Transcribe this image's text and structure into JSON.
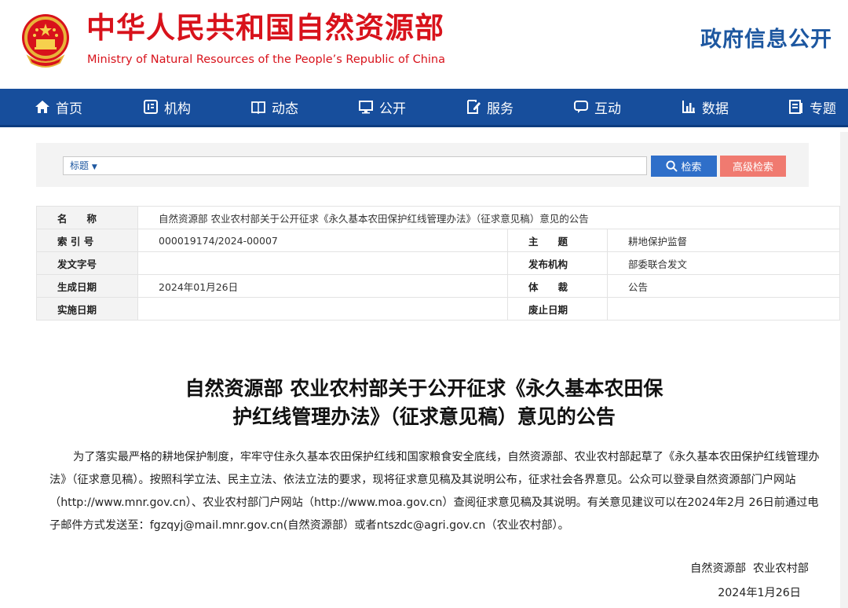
{
  "header": {
    "title": "中华人民共和国自然资源部",
    "subtitle": "Ministry of Natural Resources of the People’s Republic of China",
    "gov_info_link": "政府信息公开"
  },
  "nav": {
    "items": [
      {
        "label": "首页",
        "icon": "home-icon"
      },
      {
        "label": "机构",
        "icon": "org-icon"
      },
      {
        "label": "动态",
        "icon": "book-icon"
      },
      {
        "label": "公开",
        "icon": "monitor-icon"
      },
      {
        "label": "服务",
        "icon": "document-edit-icon"
      },
      {
        "label": "互动",
        "icon": "chat-icon"
      },
      {
        "label": "数据",
        "icon": "bar-chart-icon"
      },
      {
        "label": "专题",
        "icon": "topic-icon"
      }
    ]
  },
  "search": {
    "field_selected": "标题",
    "search_label": "检索",
    "advanced_label": "高级检索"
  },
  "meta": {
    "name_label": "名　　称",
    "name_value": "自然资源部 农业农村部关于公开征求《永久基本农田保护红线管理办法》（征求意见稿）意见的公告",
    "index_label": "索 引 号",
    "index_value": "000019174/2024-00007",
    "subject_label": "主　　题",
    "subject_value": "耕地保护监督",
    "doc_no_label": "发文字号",
    "doc_no_value": "",
    "issuer_label": "发布机构",
    "issuer_value": "部委联合发文",
    "created_label": "生成日期",
    "created_value": "2024年01月26日",
    "genre_label": "体　　裁",
    "genre_value": "公告",
    "effective_label": "实施日期",
    "effective_value": "",
    "repeal_label": "废止日期",
    "repeal_value": ""
  },
  "article": {
    "title_line1": "自然资源部 农业农村部关于公开征求《永久基本农田保",
    "title_line2": "护红线管理办法》（征求意见稿）意见的公告",
    "body": "为了落实最严格的耕地保护制度，牢牢守住永久基本农田保护红线和国家粮食安全底线，自然资源部、农业农村部起草了《永久基本农田保护红线管理办法》（征求意见稿）。按照科学立法、民主立法、依法立法的要求，现将征求意见稿及其说明公布，征求社会各界意见。公众可以登录自然资源部门户网站（http://www.mnr.gov.cn）、农业农村部门户网站（http://www.moa.gov.cn）查阅征求意见稿及其说明。有关意见建议可以在2024年2月 26日前通过电子邮件方式发送至：fgzqyj@mail.mnr.gov.cn(自然资源部）或者ntszdc@agri.gov.cn（农业农村部）。",
    "signature": "自然资源部  农业农村部",
    "date": "2024年1月26日"
  },
  "colors": {
    "brand_red": "#d8121b",
    "nav_blue": "#174e9c",
    "title_blue": "#1d57a0",
    "search_blue": "#2f6fc9",
    "advanced_red": "#f07a70"
  }
}
